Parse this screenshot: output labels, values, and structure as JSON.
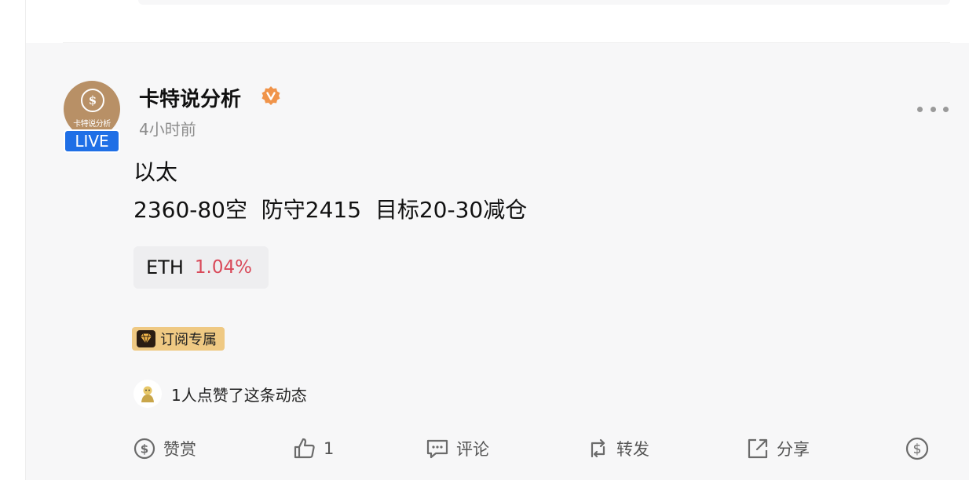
{
  "author": {
    "name": "卡特说分析",
    "avatar_text": "卡特说分析",
    "live_label": "LIVE",
    "verified_icon": "verified-badge-icon"
  },
  "post": {
    "time": "4小时前",
    "line1": "以太",
    "line2": "2360-80空  防守2415  目标20-30减仓"
  },
  "ticker": {
    "symbol": "ETH",
    "change": "1.04%",
    "change_color": "#d94a5a"
  },
  "subscription_badge": {
    "label": "订阅专属",
    "icon": "diamond-icon",
    "color": "#efc983"
  },
  "likes": {
    "text": "1人点赞了这条动态"
  },
  "actions": {
    "tip_label": "赞赏",
    "like_count": "1",
    "comment_label": "评论",
    "repost_label": "转发",
    "share_label": "分享"
  },
  "colors": {
    "live_badge": "#1f6fe6",
    "avatar_bg": "#b89066",
    "verified": "#f0944a"
  }
}
